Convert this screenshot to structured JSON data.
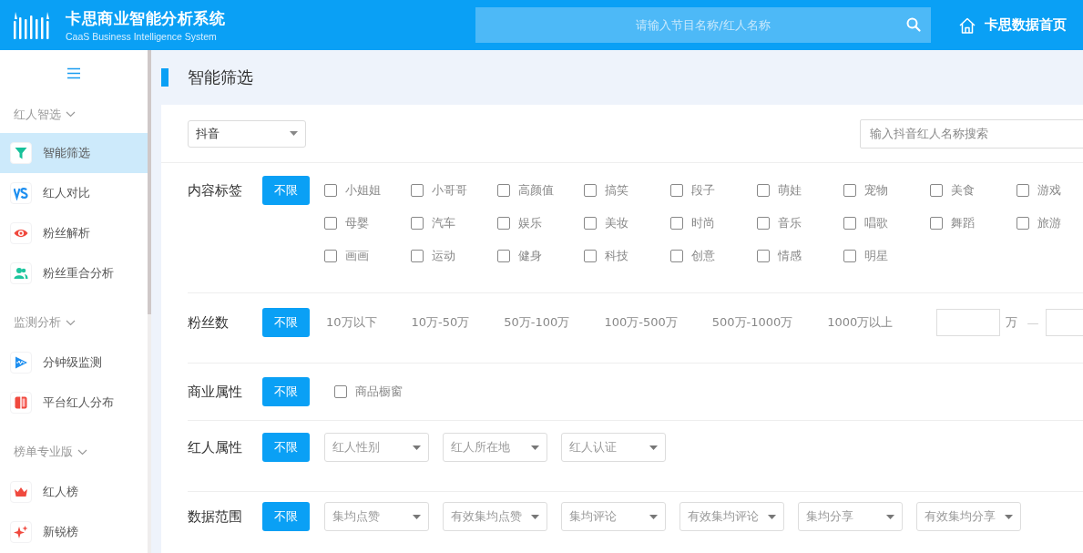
{
  "header": {
    "title": "卡思商业智能分析系统",
    "subtitle": "CaaS Business Intelligence System",
    "search": {
      "placeholder": "请输入节目名称/红人名称"
    },
    "home_link": "卡思数据首页"
  },
  "sidebar": {
    "groups": [
      {
        "title": "红人智选",
        "expanded": true,
        "items": [
          {
            "label": "智能筛选",
            "selected": true
          },
          {
            "label": "红人对比",
            "selected": false
          },
          {
            "label": "粉丝解析",
            "selected": false
          },
          {
            "label": "粉丝重合分析",
            "selected": false
          }
        ]
      },
      {
        "title": "监测分析",
        "expanded": true,
        "items": [
          {
            "label": "分钟级监测",
            "selected": false
          },
          {
            "label": "平台红人分布",
            "selected": false
          }
        ]
      },
      {
        "title": "榜单专业版",
        "expanded": true,
        "items": [
          {
            "label": "红人榜",
            "selected": false
          },
          {
            "label": "新锐榜",
            "selected": false
          }
        ]
      }
    ]
  },
  "page_title": "智能筛选",
  "platform_select": {
    "value": "抖音"
  },
  "name_search": {
    "placeholder": "输入抖音红人名称搜索"
  },
  "filters": [
    {
      "kind": "checkboxes",
      "label": "内容标签",
      "unlimited": {
        "label": "不限",
        "selected": true
      },
      "options": [
        {
          "label": "小姐姐",
          "checked": false
        },
        {
          "label": "小哥哥",
          "checked": false
        },
        {
          "label": "高颜值",
          "checked": false
        },
        {
          "label": "搞笑",
          "checked": false
        },
        {
          "label": "段子",
          "checked": false
        },
        {
          "label": "萌娃",
          "checked": false
        },
        {
          "label": "宠物",
          "checked": false
        },
        {
          "label": "美食",
          "checked": false
        },
        {
          "label": "游戏",
          "checked": false
        },
        {
          "label": "母婴",
          "checked": false
        },
        {
          "label": "汽车",
          "checked": false
        },
        {
          "label": "娱乐",
          "checked": false
        },
        {
          "label": "美妆",
          "checked": false
        },
        {
          "label": "时尚",
          "checked": false
        },
        {
          "label": "音乐",
          "checked": false
        },
        {
          "label": "唱歌",
          "checked": false
        },
        {
          "label": "舞蹈",
          "checked": false
        },
        {
          "label": "旅游",
          "checked": false
        },
        {
          "label": "画画",
          "checked": false
        },
        {
          "label": "运动",
          "checked": false
        },
        {
          "label": "健身",
          "checked": false
        },
        {
          "label": "科技",
          "checked": false
        },
        {
          "label": "创意",
          "checked": false
        },
        {
          "label": "情感",
          "checked": false
        },
        {
          "label": "明星",
          "checked": false
        }
      ]
    },
    {
      "kind": "options",
      "label": "粉丝数",
      "unlimited": {
        "label": "不限",
        "selected": true
      },
      "options": [
        {
          "label": "10万以下",
          "selected": false
        },
        {
          "label": "10万-50万",
          "selected": false
        },
        {
          "label": "50万-100万",
          "selected": false
        },
        {
          "label": "100万-500万",
          "selected": false
        },
        {
          "label": "500万-1000万",
          "selected": false
        },
        {
          "label": "1000万以上",
          "selected": false
        }
      ],
      "range": {
        "unit": "万",
        "separator": "—"
      }
    },
    {
      "kind": "single-checkbox",
      "label": "商业属性",
      "unlimited": {
        "label": "不限",
        "selected": true
      },
      "options": [
        {
          "label": "商品橱窗",
          "checked": false
        }
      ]
    },
    {
      "kind": "dropdowns",
      "label": "红人属性",
      "unlimited": {
        "label": "不限",
        "selected": true
      },
      "options": [
        {
          "placeholder": "红人性别"
        },
        {
          "placeholder": "红人所在地"
        },
        {
          "placeholder": "红人认证"
        }
      ]
    },
    {
      "kind": "dropdowns",
      "label": "数据范围",
      "unlimited": {
        "label": "不限",
        "selected": true
      },
      "options": [
        {
          "placeholder": "集均点赞"
        },
        {
          "placeholder": "有效集均点赞"
        },
        {
          "placeholder": "集均评论"
        },
        {
          "placeholder": "有效集均评论"
        },
        {
          "placeholder": "集均分享"
        },
        {
          "placeholder": "有效集均分享"
        }
      ]
    }
  ]
}
